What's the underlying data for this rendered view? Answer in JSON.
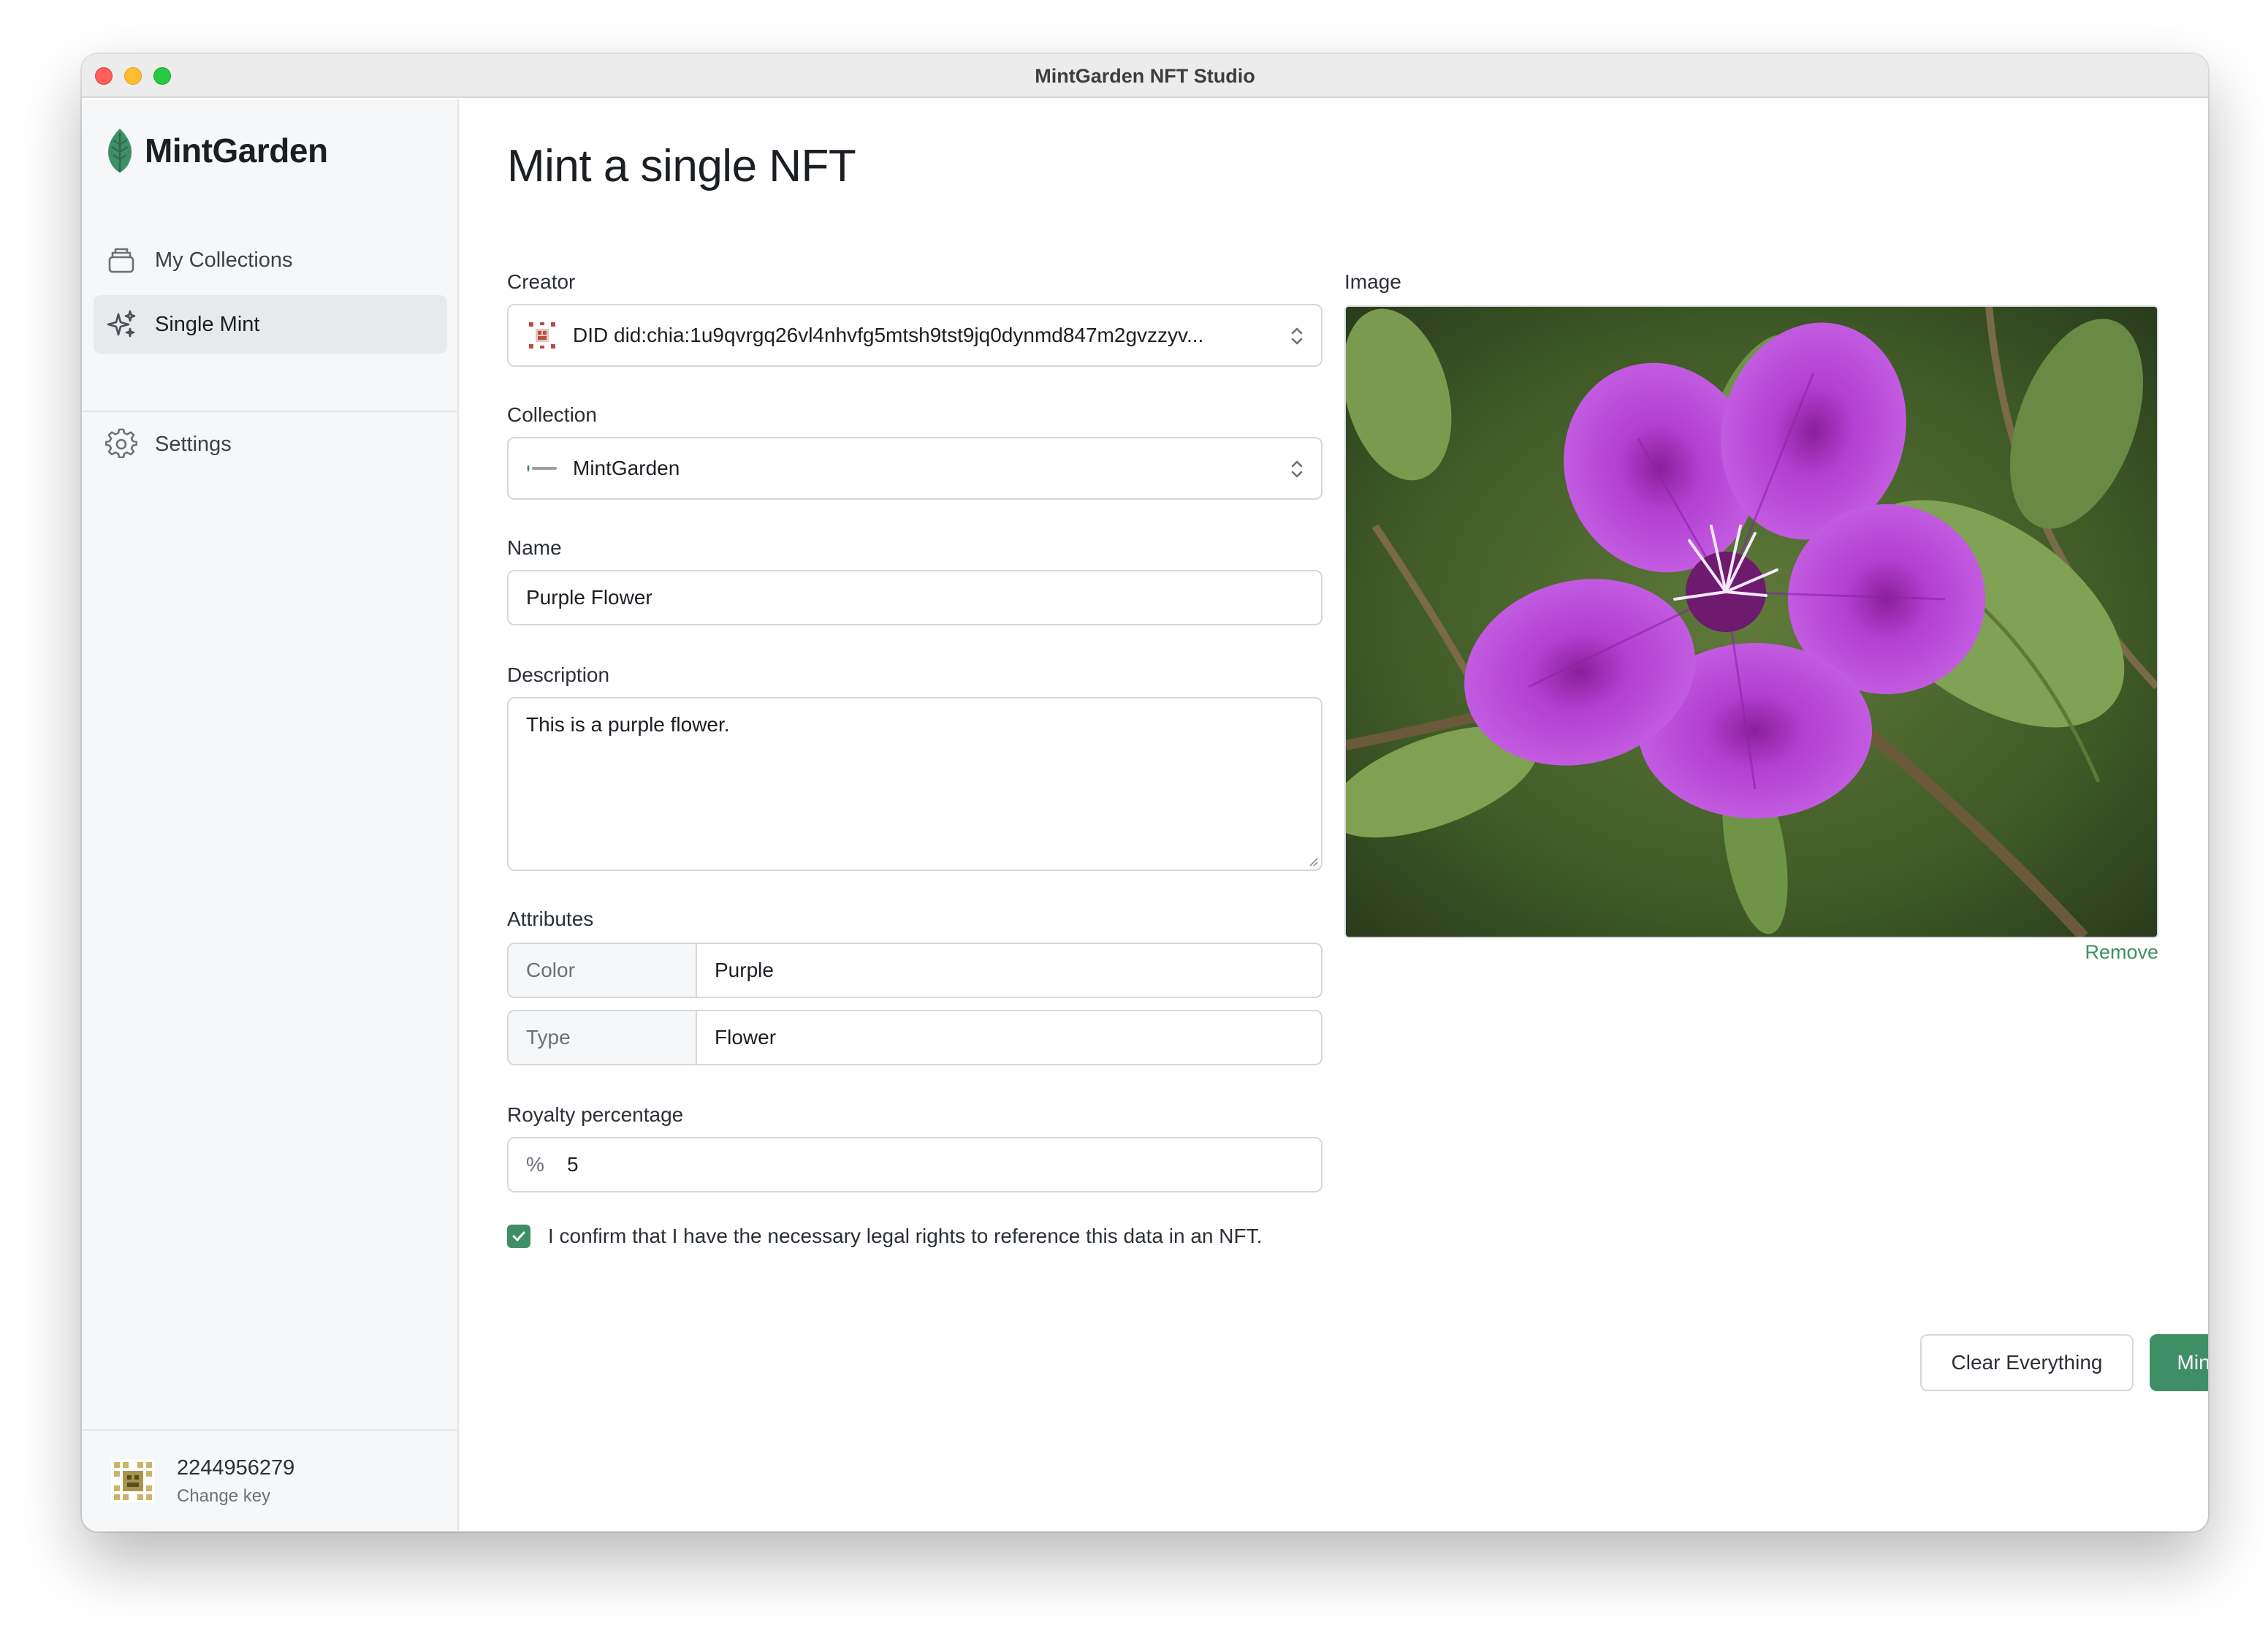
{
  "window": {
    "title": "MintGarden NFT Studio"
  },
  "sidebar": {
    "brand": "MintGarden",
    "items": [
      {
        "label": "My Collections",
        "icon": "collection-stack-icon"
      },
      {
        "label": "Single Mint",
        "icon": "sparkles-icon",
        "active": true
      },
      {
        "label": "Settings",
        "icon": "gear-icon"
      }
    ],
    "account": {
      "key": "2244956279",
      "change_label": "Change key"
    }
  },
  "main": {
    "title": "Mint a single NFT",
    "creator": {
      "label": "Creator",
      "value": "DID did:chia:1u9qvrgq26vl4nhvfg5mtsh9tst9jq0dynmd847m2gvzzyv..."
    },
    "collection": {
      "label": "Collection",
      "value": "MintGarden"
    },
    "name": {
      "label": "Name",
      "value": "Purple Flower"
    },
    "description": {
      "label": "Description",
      "value": "This is a purple flower."
    },
    "attributes": {
      "label": "Attributes",
      "rows": [
        {
          "key": "Color",
          "value": "Purple"
        },
        {
          "key": "Type",
          "value": "Flower"
        }
      ]
    },
    "royalty": {
      "label": "Royalty percentage",
      "prefix": "%",
      "value": "5"
    },
    "confirm": {
      "checked": true,
      "text": "I confirm that I have the necessary legal rights to reference this data in an NFT."
    },
    "image": {
      "label": "Image",
      "remove_label": "Remove"
    },
    "buttons": {
      "clear": "Clear Everything",
      "mint": "Mint"
    }
  },
  "colors": {
    "accent": "#3f8f66",
    "sidebar_bg": "#f6f7f8",
    "border": "#d5d8dc"
  }
}
